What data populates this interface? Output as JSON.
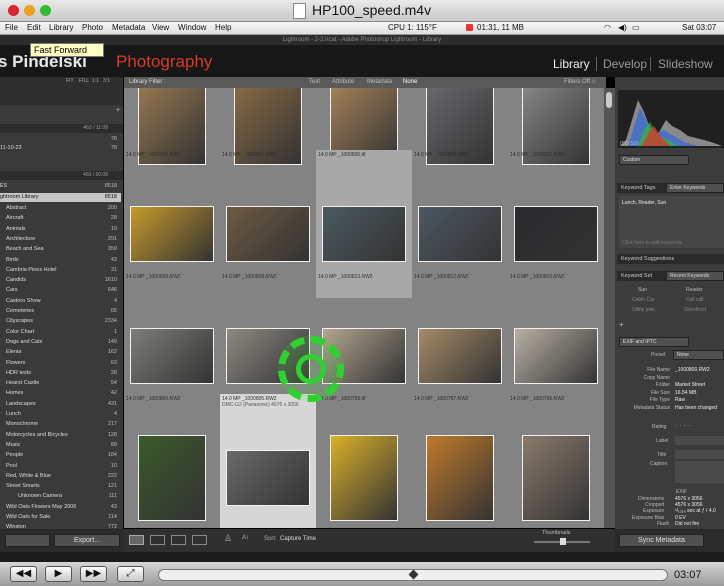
{
  "window": {
    "title": "HP100_speed.m4v"
  },
  "menubar": {
    "items": [
      "File",
      "Edit",
      "Library",
      "Photo",
      "Metadata",
      "View",
      "Window",
      "Help"
    ],
    "status": "CPU 1: 115°F",
    "clock": "01:31, 11 MB",
    "time_right": "Sat 03:07"
  },
  "tooltip": "Fast Forward",
  "lr": {
    "title": "Lightroom - 2-2.lrcat - Adobe Photoshop Lightroom - Library",
    "identity_name": "s Pindelski",
    "identity_word": "Photography",
    "modules": [
      "Library",
      "Develop",
      "Slideshow"
    ]
  },
  "filter": {
    "label": "Library Filter :",
    "options": [
      "Text",
      "Attribute",
      "Metadata",
      "None"
    ],
    "right": "Filters Off ⬦"
  },
  "left_panel": {
    "nav": [
      "FIT",
      "FILL",
      "1:1",
      "3:1"
    ],
    "head1": "463 / 11:08",
    "sub1": "78",
    "date": "11-10-23",
    "sub2": "78",
    "head2": "460 / 60:08",
    "catalog": [
      {
        "name": "ES",
        "count": "8518"
      },
      {
        "name": "ghtroom Library",
        "count": "8518"
      }
    ],
    "keywords": [
      [
        "Abstract",
        "200"
      ],
      [
        "Aircraft",
        "28"
      ],
      [
        "Animals",
        "19"
      ],
      [
        "Architecture",
        "291"
      ],
      [
        "Beach and Sea",
        "359"
      ],
      [
        "Birds",
        "43"
      ],
      [
        "Cambria Pines Hotel",
        "31"
      ],
      [
        "Candids",
        "1610"
      ],
      [
        "Cars",
        "646"
      ],
      [
        "Castoro Show",
        "4"
      ],
      [
        "Cemeteries",
        "65"
      ],
      [
        "Cityscapes",
        "2334"
      ],
      [
        "Color Chart",
        "1"
      ],
      [
        "Dogs and Cats",
        "149"
      ],
      [
        "Elenia",
        "162"
      ],
      [
        "Flowers",
        "63"
      ],
      [
        "HDR tests",
        "28"
      ],
      [
        "Hearst Castle",
        "54"
      ],
      [
        "Homes",
        "42"
      ],
      [
        "Landscapes",
        "431"
      ],
      [
        "Lunch",
        "4"
      ],
      [
        "Monochrome",
        "217"
      ],
      [
        "Motorcycles and Bicycles",
        "128"
      ],
      [
        "Music",
        "89"
      ],
      [
        "People",
        "184"
      ],
      [
        "Pool",
        "10"
      ],
      [
        "Red, White & Blue",
        "222"
      ],
      [
        "Street Smarts",
        "121"
      ],
      [
        "Unknown Camera",
        "111"
      ],
      [
        "Wild Oats Flowers May 2006",
        "43"
      ],
      [
        "Wild Oats for Sale",
        "114"
      ],
      [
        "Winston",
        "772"
      ]
    ],
    "export": "Export..."
  },
  "grid": {
    "rows": [
      {
        "headers": [
          "",
          "",
          "",
          "",
          ""
        ]
      },
      {
        "headers": [
          "14.0 MP       _1000845.RW2",
          "14.0 MP       _1000841.RW2",
          "14.0 MP       _1000836.tif",
          "14.0 MP       _1000834.RW2",
          "14.0 MP       _1000832.RW2"
        ]
      },
      {
        "headers": [
          "14.0 MP       _1000839.RW2",
          "14.0 MP       _1000828.RW2",
          "14.0 MP       _1000813.RW2",
          "14.0 MP       _1000812.RW2",
          "14.0 MP       _1000810.RW2"
        ]
      },
      {
        "headers": [
          "14.0 MP       _1000806.RW2",
          "14.0 MP       _1000805.RW2",
          "14.0 MP       _1000799.tif",
          "14.0 MP       _1000797.RW2",
          "14.0 MP       _1000796.RW2"
        ]
      }
    ],
    "extra_header": "DMC-G2 (Panasonic)     4576 x 3056"
  },
  "right_panel": {
    "hist_info": "ISO 320",
    "preset_label": "Custom",
    "keyword_tags": "Keyword Tags",
    "enter_keywords": "Enter Keywords",
    "keywords_value": "Lunch, Reader, Sun",
    "click_add": "Click here to add keywords",
    "suggestions": "Keyword Suggestions",
    "keyword_set": "Keyword Set",
    "recent": "Recent Keywords",
    "set_words": [
      "Sun",
      "Reader",
      "Cabin Car",
      "Cell call",
      "Utility pole",
      "Storefront"
    ],
    "exif_label": "EXIF and IPTC",
    "preset": "Preset",
    "preset_val": "None",
    "fields": [
      [
        "File Name",
        "_1000800.RW2"
      ],
      [
        "Copy Name",
        ""
      ],
      [
        "Folder",
        "Market Street"
      ],
      [
        "File Size",
        "16.54 MB"
      ],
      [
        "File Type",
        "Raw"
      ],
      [
        "Metadata Status",
        "Has been changed"
      ]
    ],
    "rating": "Rating",
    "label": "Label",
    "title": "Title",
    "caption": "Caption",
    "exif": "EXIF",
    "dimensions": [
      "Dimensions",
      "4576 x 3056"
    ],
    "cropped": [
      "Cropped",
      "4576 x 3056"
    ],
    "exposure": [
      "Exposure",
      "¹/₁₂₅₀ sec at ƒ / 4.0"
    ],
    "bias": [
      "Exposure Bias",
      "0 EV"
    ],
    "flash": [
      "Flash",
      "Did not fire"
    ],
    "sync": "Sync Metadata"
  },
  "toolbar": {
    "sort_label": "Sort:",
    "sort_value": "Capture Time",
    "thumbs": "Thumbnails"
  },
  "player": {
    "timecode": "03:07",
    "progress": 0.5
  }
}
